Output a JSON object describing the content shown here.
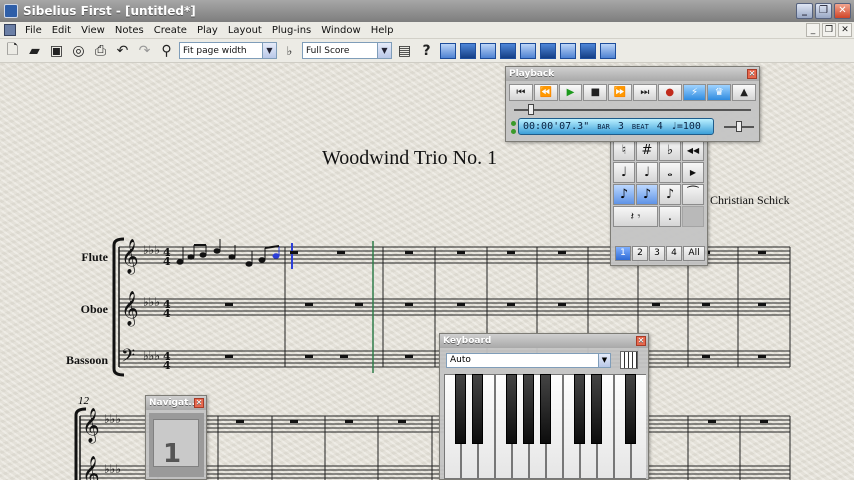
{
  "window": {
    "title": "Sibelius First - [untitled*]"
  },
  "menu": [
    "File",
    "Edit",
    "View",
    "Notes",
    "Create",
    "Play",
    "Layout",
    "Plug-ins",
    "Window",
    "Help"
  ],
  "toolbar": {
    "zoom_value": "Fit page width",
    "part_value": "Full Score"
  },
  "score": {
    "title": "Woodwind Trio No. 1",
    "composer": "Christian Schick",
    "instruments": [
      "Flute",
      "Oboe",
      "Bassoon"
    ],
    "second_system_bar": "12"
  },
  "playback": {
    "title": "Playback",
    "time": "00:00'07.3\"",
    "bar_label": "BAR",
    "bar": "3",
    "beat_label": "BEAT",
    "beat": "4",
    "tempo": "♩=100"
  },
  "keypad": {
    "keys": [
      "♮",
      "#",
      "♭",
      "◀◀",
      "♩",
      "♩",
      "𝅝",
      "▶",
      "♪",
      "♪",
      "♪",
      "⁀",
      "𝄽 𝄾",
      ".",
      "",
      ""
    ],
    "layouts": [
      "1",
      "2",
      "3",
      "4",
      "All"
    ]
  },
  "keyboard": {
    "title": "Keyboard",
    "mode": "Auto"
  },
  "navigator": {
    "title": "Navigat...",
    "page": "1"
  },
  "icons": {
    "title_bar": [
      "app-icon",
      "minimize-icon",
      "restore-icon",
      "close-icon"
    ],
    "toolbar": [
      "new-icon",
      "open-icon",
      "save-icon",
      "scan-icon",
      "print-icon",
      "undo-icon",
      "redo-icon",
      "zoom-icon",
      "transpose-icon",
      "properties-icon",
      "help-icon"
    ]
  }
}
